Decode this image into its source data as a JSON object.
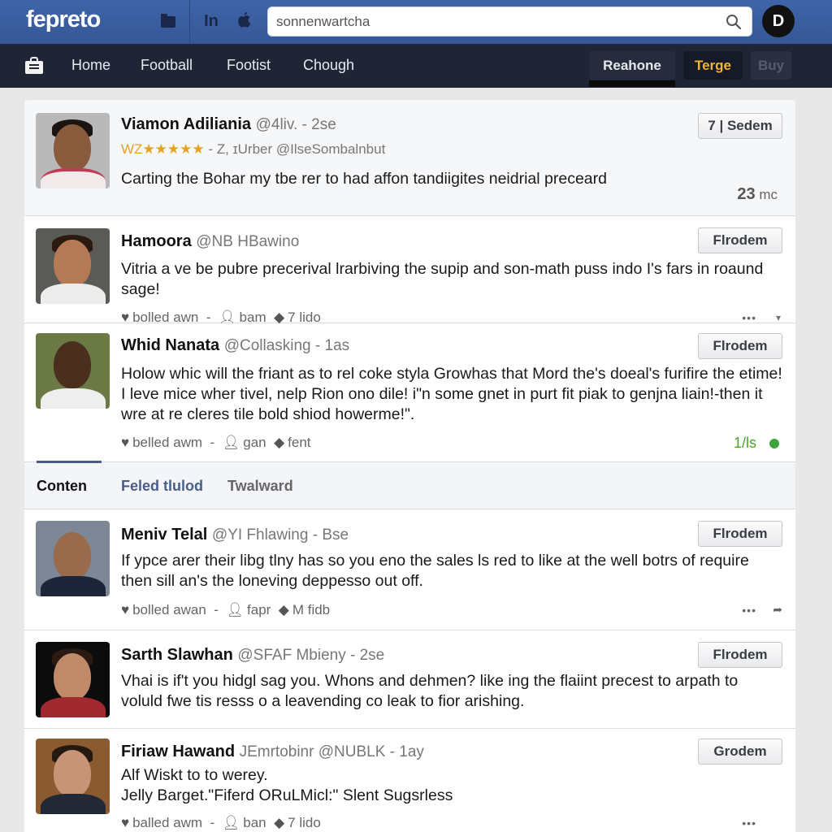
{
  "topbar": {
    "logo": "fepreto",
    "icons": [
      "folder-icon",
      "linkedin-icon",
      "apple-icon"
    ],
    "linkedin_glyph": "In",
    "search": {
      "value": "sonnenwartcha",
      "placeholder": "",
      "icon": "search-icon"
    },
    "profile_glyph": "D"
  },
  "navbar": {
    "links": [
      "Home",
      "Football",
      "Footist",
      "Chough"
    ],
    "buttons": {
      "reahone": "Reahone",
      "terge": "Terge",
      "buy": "Buy"
    }
  },
  "posts": [
    {
      "name": "Viamon Adiliania",
      "handle": "@4liv. - 2se",
      "rating_prefix": "WZ",
      "rating_stars": "★★★★★",
      "rating_suffix": " - Z, ɪUrber @IlseSombalnbut",
      "text": "Carting the Bohar my tbe rer to had affon tandiigites neidrial preceard",
      "button": "7 | Sedem",
      "time_value": "23",
      "time_unit": "mc"
    },
    {
      "name": "Hamoora",
      "handle": "@NB HBawino",
      "text": "Vitria a ve be pubre precerival lrarbiving the supip and son-math puss indo I's fars in roaund sage!",
      "button": "Flrodem",
      "meta": {
        "likes": "bolled awn",
        "sep": "-",
        "user": "bam",
        "tag": "7 lido"
      }
    },
    {
      "name": "Whid Nanata",
      "handle": "@Collasking - 1as",
      "text": "Holow whic will the friant as to rel coke styla Growhas that Mord the's doeal's furifire the etime! I leve mice wher tivel, nelp Rion ono dile! i\"n some gnet in purt fit piak to genjna liain!-then it wre at re cleres tile bold shiod howerme!\".",
      "button": "Flrodem",
      "meta": {
        "likes": "belled awm",
        "sep": "-",
        "user": "gan",
        "tag": "fent"
      },
      "status_count": "1/ls",
      "status_color": "#3ea43a"
    },
    {
      "name": "Meniv Telal",
      "handle": "@YI Fhlawing - Bse",
      "text": "If ypce arer their libg tlny has so you eno the sales ls red to like at the well botrs of require then sill an's the loneving deppesso out off.",
      "button": "Flrodem",
      "meta": {
        "likes": "bolled awan",
        "sep": "-",
        "user": "fapr",
        "tag": "M fidb"
      }
    },
    {
      "name": "Sarth Slawhan",
      "handle": "@SFAF Mbieny - 2se",
      "text": "Vhai is if't you hidgl sag you. Whons and dehmen? like ing the flaiint precest to arpath to voluld fwe tis resss o a leavending co leak to fior arishing.",
      "button": "Flrodem"
    },
    {
      "name": "Firiaw Hawand",
      "handle": "JEmrtobinr @NUBLK - 1ay",
      "text": "Alf Wiskt to to werey.\nJelly Barget.\"Fiferd ORuLMicl:\" Slent Sugsrless",
      "button": "Grodem",
      "meta": {
        "likes": "balled awm",
        "sep": "-",
        "user": "ban",
        "tag": "7 lido"
      }
    }
  ],
  "tabs": {
    "items": [
      "Conten",
      "Feled tlulod",
      "Twalward"
    ],
    "active": "Conten"
  },
  "colors": {
    "topbar": "#3f64a8",
    "navbar": "#1f2535",
    "accent_gold": "#f0b535",
    "star_gold": "#e8a21d",
    "status_green": "#3ea43a",
    "tab_link": "#4a5d8a"
  }
}
